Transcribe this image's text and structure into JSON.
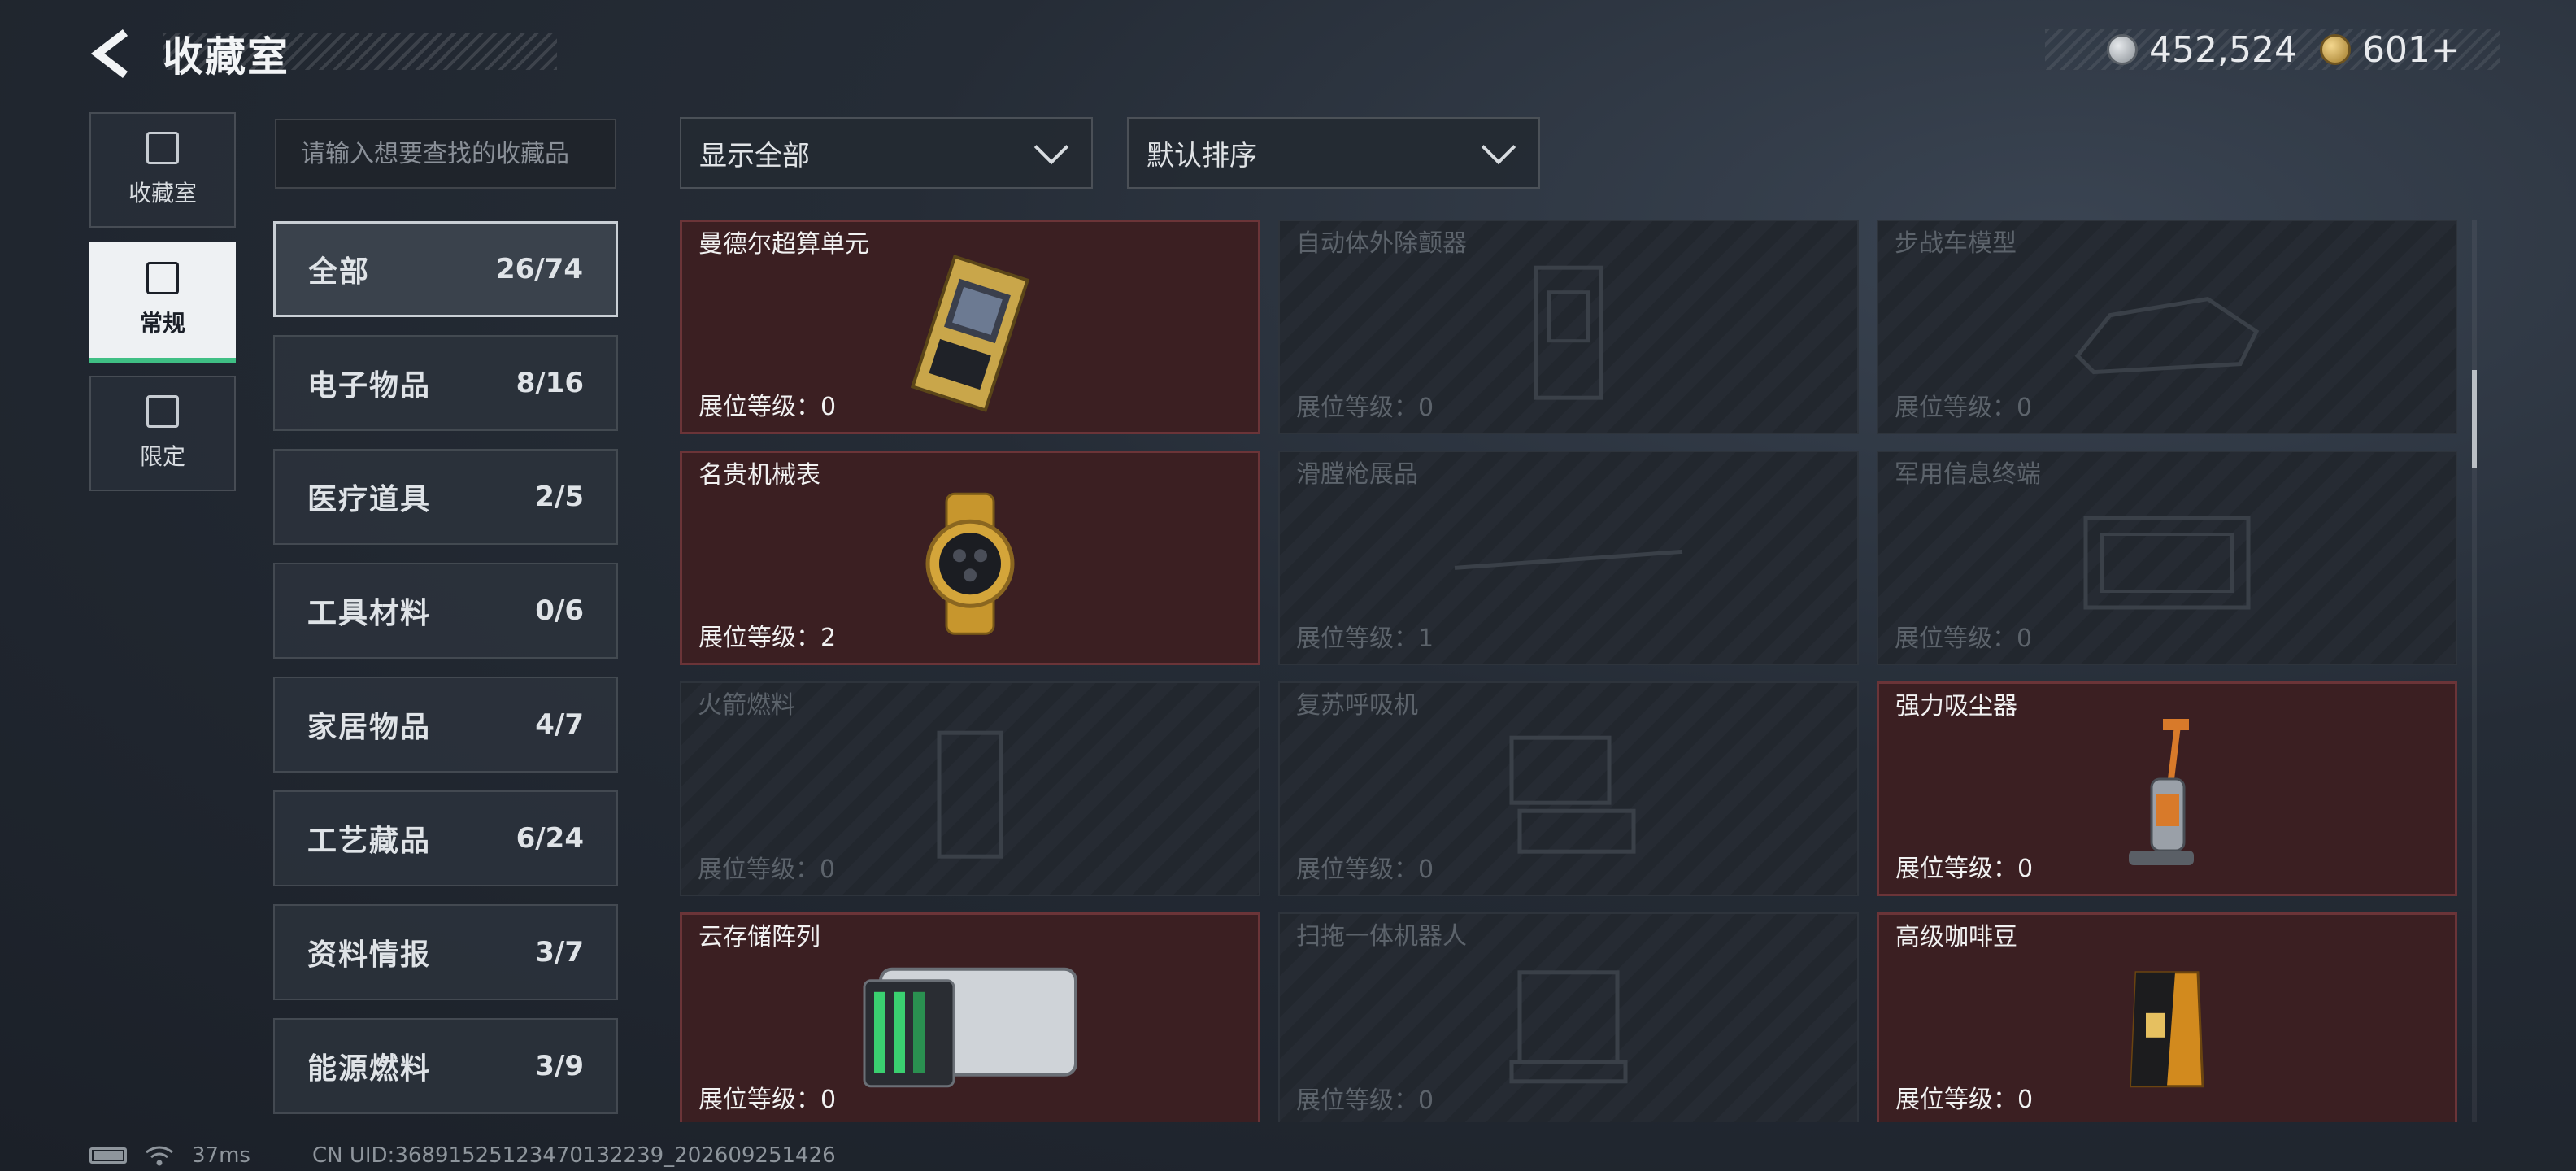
{
  "header": {
    "title": "收藏室"
  },
  "currency": {
    "silver": "452,524",
    "gold": "601+"
  },
  "side_tabs": [
    {
      "label": "收藏室",
      "icon": "display-case-icon",
      "active": false
    },
    {
      "label": "常规",
      "icon": "gallery-icon",
      "active": true
    },
    {
      "label": "限定",
      "icon": "limited-icon",
      "active": false
    }
  ],
  "search": {
    "placeholder": "请输入想要查找的收藏品"
  },
  "filters": {
    "display": "显示全部",
    "sort": "默认排序"
  },
  "categories": [
    {
      "name": "全部",
      "count": "26/74",
      "active": true
    },
    {
      "name": "电子物品",
      "count": "8/16"
    },
    {
      "name": "医疗道具",
      "count": "2/5"
    },
    {
      "name": "工具材料",
      "count": "0/6"
    },
    {
      "name": "家居物品",
      "count": "4/7"
    },
    {
      "name": "工艺藏品",
      "count": "6/24"
    },
    {
      "name": "资料情报",
      "count": "3/7"
    },
    {
      "name": "能源燃料",
      "count": "3/9"
    }
  ],
  "items": [
    {
      "name": "曼德尔超算单元",
      "level": "展位等级：0",
      "owned": true,
      "icon": "supercomputer-unit-icon"
    },
    {
      "name": "自动体外除颤器",
      "level": "展位等级：0",
      "owned": false,
      "icon": "defibrillator-icon"
    },
    {
      "name": "步战车模型",
      "level": "展位等级：0",
      "owned": false,
      "icon": "vehicle-model-icon"
    },
    {
      "name": "名贵机械表",
      "level": "展位等级：2",
      "owned": true,
      "icon": "wristwatch-icon"
    },
    {
      "name": "滑膛枪展品",
      "level": "展位等级：1",
      "owned": false,
      "icon": "musket-icon"
    },
    {
      "name": "军用信息终端",
      "level": "展位等级：0",
      "owned": false,
      "icon": "military-terminal-icon"
    },
    {
      "name": "火箭燃料",
      "level": "展位等级：0",
      "owned": false,
      "icon": "rocket-fuel-icon"
    },
    {
      "name": "复苏呼吸机",
      "level": "展位等级：0",
      "owned": false,
      "icon": "ventilator-icon"
    },
    {
      "name": "强力吸尘器",
      "level": "展位等级：0",
      "owned": true,
      "icon": "vacuum-cleaner-icon"
    },
    {
      "name": "云存储阵列",
      "level": "展位等级：0",
      "owned": true,
      "icon": "storage-array-icon"
    },
    {
      "name": "扫拖一体机器人",
      "level": "展位等级：0",
      "owned": false,
      "icon": "mop-robot-icon"
    },
    {
      "name": "高级咖啡豆",
      "level": "展位等级：0",
      "owned": true,
      "icon": "coffee-bag-icon"
    }
  ],
  "footer": {
    "ping": "37ms",
    "uid": "CN UID:36891525123470132239_202609251426"
  }
}
